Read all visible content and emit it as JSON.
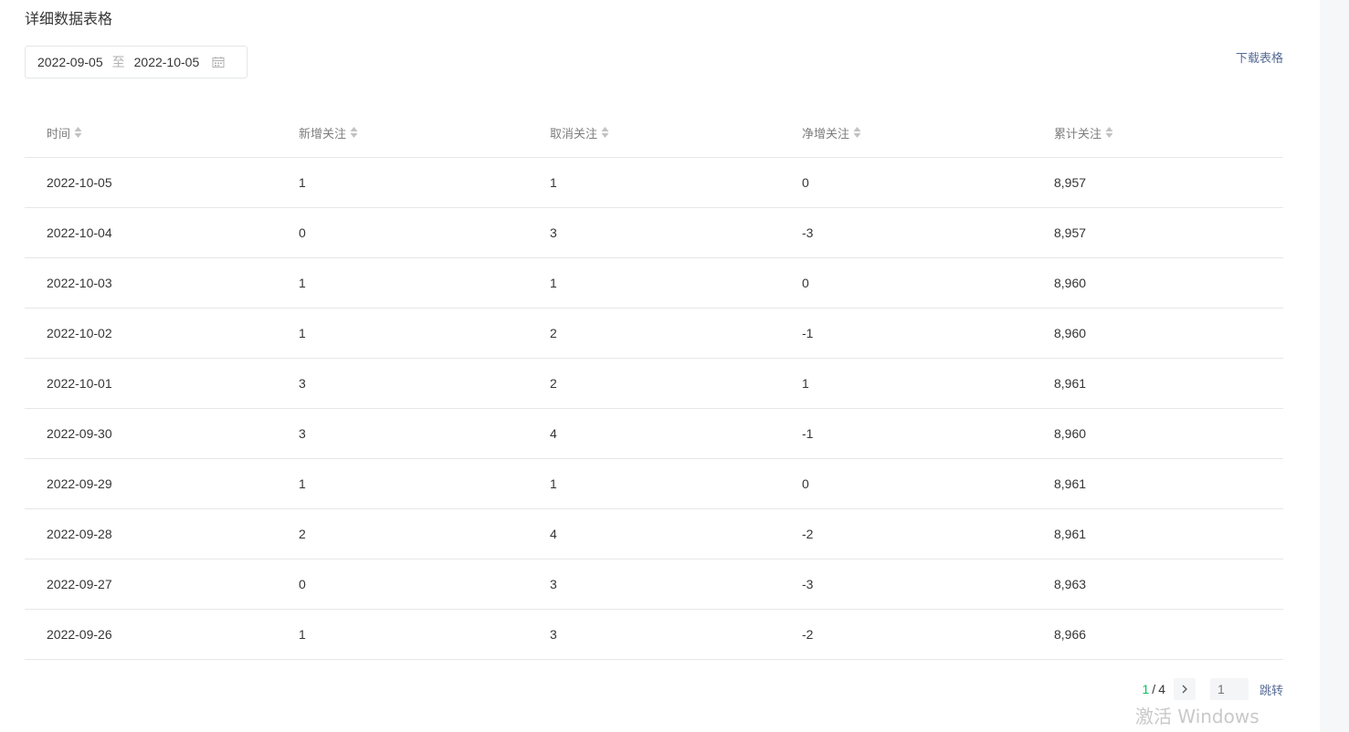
{
  "section": {
    "title": "详细数据表格"
  },
  "date_range": {
    "start": "2022-09-05",
    "separator": "至",
    "end": "2022-10-05",
    "icon": "calendar-icon"
  },
  "actions": {
    "download_label": "下载表格"
  },
  "table": {
    "columns": [
      "时间",
      "新增关注",
      "取消关注",
      "净增关注",
      "累计关注"
    ],
    "rows": [
      [
        "2022-10-05",
        "1",
        "1",
        "0",
        "8,957"
      ],
      [
        "2022-10-04",
        "0",
        "3",
        "-3",
        "8,957"
      ],
      [
        "2022-10-03",
        "1",
        "1",
        "0",
        "8,960"
      ],
      [
        "2022-10-02",
        "1",
        "2",
        "-1",
        "8,960"
      ],
      [
        "2022-10-01",
        "3",
        "2",
        "1",
        "8,961"
      ],
      [
        "2022-09-30",
        "3",
        "4",
        "-1",
        "8,960"
      ],
      [
        "2022-09-29",
        "1",
        "1",
        "0",
        "8,961"
      ],
      [
        "2022-09-28",
        "2",
        "4",
        "-2",
        "8,961"
      ],
      [
        "2022-09-27",
        "0",
        "3",
        "-3",
        "8,963"
      ],
      [
        "2022-09-26",
        "1",
        "3",
        "-2",
        "8,966"
      ]
    ]
  },
  "pagination": {
    "current": "1",
    "separator": "/",
    "total": "4",
    "input_placeholder": "1",
    "jump_label": "跳转"
  },
  "watermark": {
    "text": "激活 Windows"
  },
  "colors": {
    "accent_green": "#07c160",
    "link_blue": "#576b95",
    "border": "#e7e7eb"
  }
}
